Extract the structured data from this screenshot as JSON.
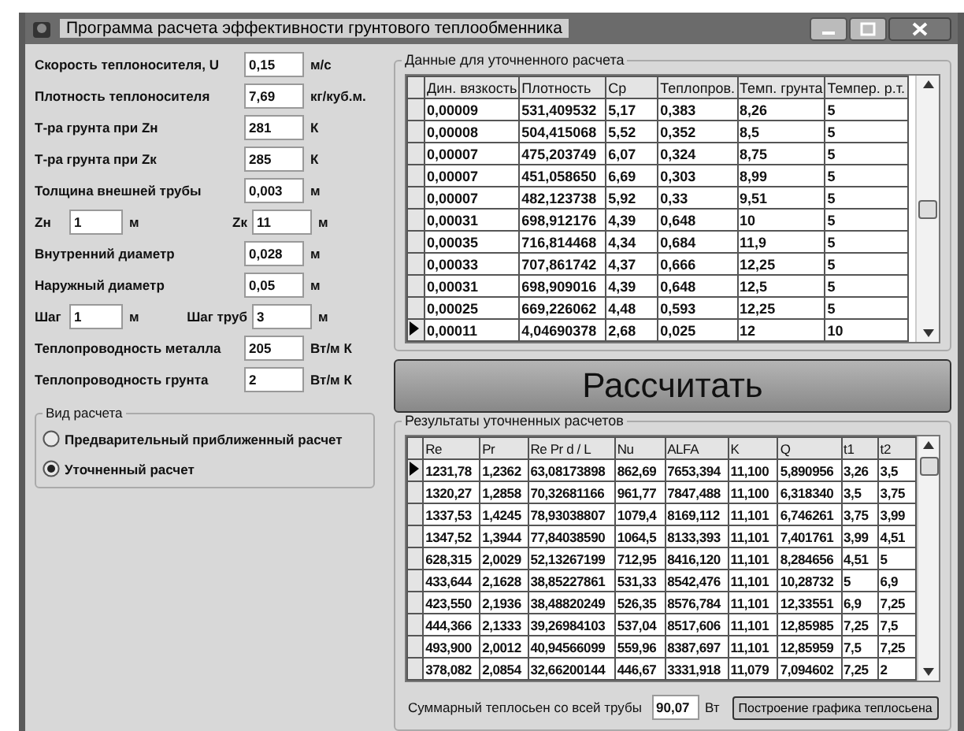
{
  "window": {
    "title": "Программа расчета эффективности грунтового теплообменника"
  },
  "params": [
    {
      "kind": "single",
      "label": "Скорость теплоносителя, U",
      "value": "0,15",
      "unit": "м/с"
    },
    {
      "kind": "single",
      "label": "Плотность теплоносителя",
      "value": "7,69",
      "unit": "кг/куб.м."
    },
    {
      "kind": "single",
      "label": "Т-ра грунта при Zн",
      "value": "281",
      "unit": "К"
    },
    {
      "kind": "single",
      "label": "Т-ра грунта при Zк",
      "value": "285",
      "unit": "К"
    },
    {
      "kind": "single",
      "label": "Толщина внешней трубы",
      "value": "0,003",
      "unit": "м"
    },
    {
      "kind": "pair",
      "items": [
        {
          "label": "Zн",
          "value": "1",
          "unit": "м"
        },
        {
          "label": "Zк",
          "value": "11",
          "unit": "м"
        }
      ]
    },
    {
      "kind": "single",
      "label": "Внутренний диаметр",
      "value": "0,028",
      "unit": "м"
    },
    {
      "kind": "single",
      "label": "Наружный диаметр",
      "value": "0,05",
      "unit": "м"
    },
    {
      "kind": "pair",
      "items": [
        {
          "label": "Шаг",
          "value": "1",
          "unit": "м"
        },
        {
          "label": "Шаг труб",
          "value": "3",
          "unit": "м"
        }
      ]
    },
    {
      "kind": "single",
      "label": "Теплопроводность металла",
      "value": "205",
      "unit": "Вт/м К"
    },
    {
      "kind": "single",
      "label": "Теплопроводность грунта",
      "value": "2",
      "unit": "Вт/м К"
    }
  ],
  "calc_type": {
    "title": "Вид расчета",
    "options": [
      {
        "label": "Предварительный приближенный расчет",
        "selected": false
      },
      {
        "label": "Уточненный расчет",
        "selected": true
      }
    ]
  },
  "input_table": {
    "title": "Данные для уточненного расчета",
    "columns": [
      "Дин. вязкость",
      "Плотность",
      "Cp",
      "Теплопров.",
      "Темп. грунта",
      "Темпер. р.т."
    ],
    "rows": [
      {
        "current": false,
        "cells": [
          "0,00009",
          "531,409532",
          "5,17",
          "0,383",
          "8,26",
          "5"
        ]
      },
      {
        "current": false,
        "cells": [
          "0,00008",
          "504,415068",
          "5,52",
          "0,352",
          "8,5",
          "5"
        ]
      },
      {
        "current": false,
        "cells": [
          "0,00007",
          "475,203749",
          "6,07",
          "0,324",
          "8,75",
          "5"
        ]
      },
      {
        "current": false,
        "cells": [
          "0,00007",
          "451,058650",
          "6,69",
          "0,303",
          "8,99",
          "5"
        ]
      },
      {
        "current": false,
        "cells": [
          "0,00007",
          "482,123738",
          "5,92",
          "0,33",
          "9,51",
          "5"
        ]
      },
      {
        "current": false,
        "cells": [
          "0,00031",
          "698,912176",
          "4,39",
          "0,648",
          "10",
          "5"
        ]
      },
      {
        "current": false,
        "cells": [
          "0,00035",
          "716,814468",
          "4,34",
          "0,684",
          "11,9",
          "5"
        ]
      },
      {
        "current": false,
        "cells": [
          "0,00033",
          "707,861742",
          "4,37",
          "0,666",
          "12,25",
          "5"
        ]
      },
      {
        "current": false,
        "cells": [
          "0,00031",
          "698,909016",
          "4,39",
          "0,648",
          "12,5",
          "5"
        ]
      },
      {
        "current": false,
        "cells": [
          "0,00025",
          "669,226062",
          "4,48",
          "0,593",
          "12,25",
          "5"
        ]
      },
      {
        "current": true,
        "cells": [
          "0,00011",
          "4,04690378",
          "2,68",
          "0,025",
          "12",
          "10"
        ]
      }
    ]
  },
  "calculate_button": "Рассчитать",
  "results_table": {
    "title": "Результаты уточненных расчетов",
    "columns": [
      "Re",
      "Pr",
      "Re Pr d / L",
      "Nu",
      "ALFA",
      "K",
      "Q",
      "t1",
      "t2"
    ],
    "rows": [
      {
        "current": true,
        "cells": [
          "1231,78",
          "1,2362",
          "63,08173898",
          "862,69",
          "7653,394",
          "11,100",
          "5,890956",
          "3,26",
          "3,5"
        ]
      },
      {
        "current": false,
        "cells": [
          "1320,27",
          "1,2858",
          "70,32681166",
          "961,77",
          "7847,488",
          "11,100",
          "6,318340",
          "3,5",
          "3,75"
        ]
      },
      {
        "current": false,
        "cells": [
          "1337,53",
          "1,4245",
          "78,93038807",
          "1079,4",
          "8169,112",
          "11,101",
          "6,746261",
          "3,75",
          "3,99"
        ]
      },
      {
        "current": false,
        "cells": [
          "1347,52",
          "1,3944",
          "77,84038590",
          "1064,5",
          "8133,393",
          "11,101",
          "7,401761",
          "3,99",
          "4,51"
        ]
      },
      {
        "current": false,
        "cells": [
          "628,315",
          "2,0029",
          "52,13267199",
          "712,95",
          "8416,120",
          "11,101",
          "8,284656",
          "4,51",
          "5"
        ]
      },
      {
        "current": false,
        "cells": [
          "433,644",
          "2,1628",
          "38,85227861",
          "531,33",
          "8542,476",
          "11,101",
          "10,28732",
          "5",
          "6,9"
        ]
      },
      {
        "current": false,
        "cells": [
          "423,550",
          "2,1936",
          "38,48820249",
          "526,35",
          "8576,784",
          "11,101",
          "12,33551",
          "6,9",
          "7,25"
        ]
      },
      {
        "current": false,
        "cells": [
          "444,366",
          "2,1333",
          "39,26984103",
          "537,04",
          "8517,606",
          "11,101",
          "12,85985",
          "7,25",
          "7,5"
        ]
      },
      {
        "current": false,
        "cells": [
          "493,900",
          "2,0012",
          "40,94566099",
          "559,96",
          "8387,697",
          "11,101",
          "12,85959",
          "7,5",
          "7,25"
        ]
      },
      {
        "current": false,
        "cells": [
          "378,082",
          "2,0854",
          "32,66200144",
          "446,67",
          "3331,918",
          "11,079",
          "7,094602",
          "7,25",
          "2"
        ]
      }
    ]
  },
  "total": {
    "label": "Суммарный теплосьен со всей трубы",
    "value": "90,07",
    "unit": "Вт"
  },
  "chart_button": "Построение графика теплосьена"
}
